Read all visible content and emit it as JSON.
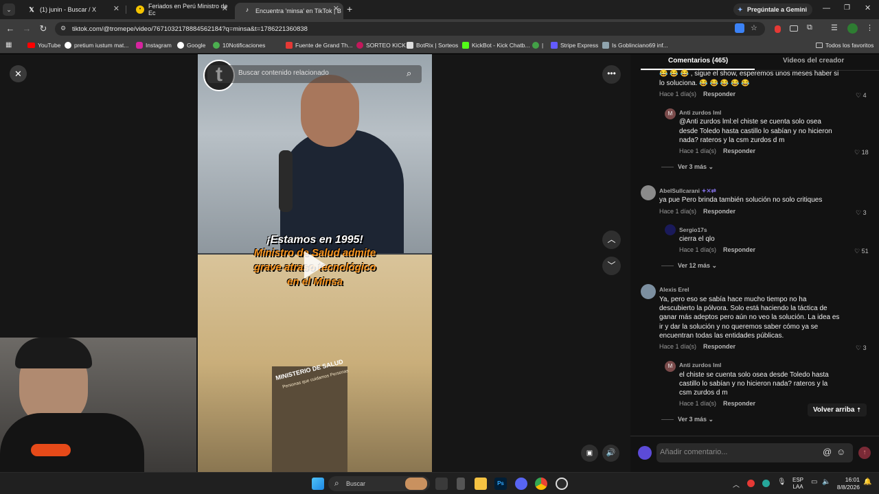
{
  "tabs": [
    {
      "title": "(1) junin - Buscar / X"
    },
    {
      "title": "Feriados en Perú Ministro de Ec"
    },
    {
      "title": "Encuentra 'minsa' en TikTok | B"
    }
  ],
  "new_tab": "+",
  "gemini": "Pregúntale a Gemini",
  "url": "tiktok.com/@tromepe/video/7671032178884562184?q=minsa&t=1786221360838",
  "bookmarks": [
    {
      "label": "YouTube"
    },
    {
      "label": "pretium iustum mat..."
    },
    {
      "label": "Instagram"
    },
    {
      "label": "Google"
    },
    {
      "label": "10Notificaciones"
    },
    {
      "label": "Fuente de Grand Th..."
    },
    {
      "label": "SORTEO KICK"
    },
    {
      "label": "BotRix | Sorteos"
    },
    {
      "label": "KickBot - Kick Chatb..."
    },
    {
      "label": "|"
    },
    {
      "label": "Stripe Express"
    },
    {
      "label": "Is Goblinciano69 inf..."
    },
    {
      "label": "Todos los favoritos"
    }
  ],
  "video": {
    "search_placeholder": "Buscar contenido relacionado",
    "caption_line1": "¡Estamos en 1995!",
    "caption_line2": "Ministro de Salud admite",
    "caption_line3": "grave atraso tecnológico",
    "caption_line4": "en el Minsa",
    "building_sign": "MINISTERIO DE SALUD",
    "building_sub": "Personas que cuidamos Personas"
  },
  "right_tabs": {
    "comments": "Comentarios (465)",
    "creator": "Videos del creador"
  },
  "comments": [
    {
      "text1": "😂 😂 😂 , sigue el show, esperemos unos meses haber si",
      "text2": "lo soluciona. 😂 😂 😂 😂 😂",
      "time": "Hace 1 día(s)",
      "reply": "Responder",
      "likes": "4"
    },
    {
      "user": "Anti zurdos lml",
      "text1": "@Anti zurdos lml:el chiste se cuenta solo osea",
      "text2": "desde Toledo hasta castillo lo sabían y no hicieron",
      "text3": "nada? rateros y la csm zurdos d m",
      "time": "Hace 1 día(s)",
      "reply": "Responder",
      "likes": "18",
      "more": "Ver 3 más"
    },
    {
      "user": "AbelSullcarani",
      "text1": "ya pue Pero brinda también solución no solo critiques",
      "time": "Hace 1 día(s)",
      "reply": "Responder",
      "likes": "3"
    },
    {
      "user": "Sergio17s",
      "text1": "cierra el qlo",
      "time": "Hace 1 día(s)",
      "reply": "Responder",
      "likes": "51",
      "more": "Ver 12 más"
    },
    {
      "user": "Alexis Erel",
      "text1": "Ya, pero eso se sabía hace mucho tiempo no ha",
      "text2": "descubierto la pólvora. Solo está haciendo la táctica de",
      "text3": "ganar más adeptos pero aún no veo la solución. La idea es",
      "text4": "ir y dar la solución y no queremos saber cómo ya se",
      "text5": "encuentran todas las entidades públicas.",
      "time": "Hace 1 día(s)",
      "reply": "Responder",
      "likes": "3"
    },
    {
      "user": "Anti zurdos lml",
      "text1": "el chiste se cuenta solo osea desde Toledo hasta",
      "text2": "castillo lo sabían y no hicieron nada? rateros y la",
      "text3": "csm zurdos d m",
      "time": "Hace 1 día(s)",
      "reply": "Responder",
      "more": "Ver 3 más"
    }
  ],
  "back_to_top": "Volver arriba",
  "comment_placeholder": "Añadir comentario...",
  "taskbar": {
    "search": "Buscar",
    "lang1": "ESP",
    "lang2": "LAA",
    "time": "16:01",
    "date": "8/8/2026"
  },
  "colors": {
    "accent": "#fe2c55",
    "tiktok_bg": "#121212",
    "chrome_bar": "#3c3c3c"
  }
}
